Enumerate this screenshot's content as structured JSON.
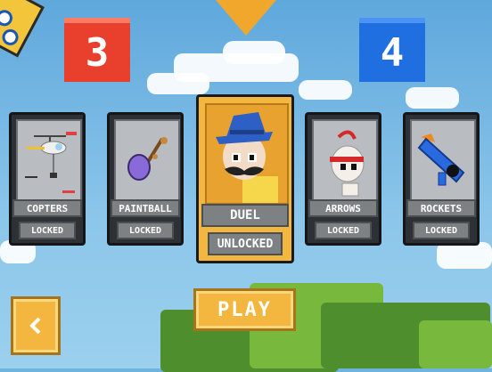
{
  "scores": {
    "red": "3",
    "blue": "4"
  },
  "modes": [
    {
      "name": "COPTERS",
      "status": "LOCKED"
    },
    {
      "name": "PAINTBALL",
      "status": "LOCKED"
    },
    {
      "name": "DUEL",
      "status": "UNLOCKED"
    },
    {
      "name": "ARROWS",
      "status": "LOCKED"
    },
    {
      "name": "ROCKETS",
      "status": "LOCKED"
    }
  ],
  "play_label": "PLAY",
  "selected_mode": "DUEL"
}
